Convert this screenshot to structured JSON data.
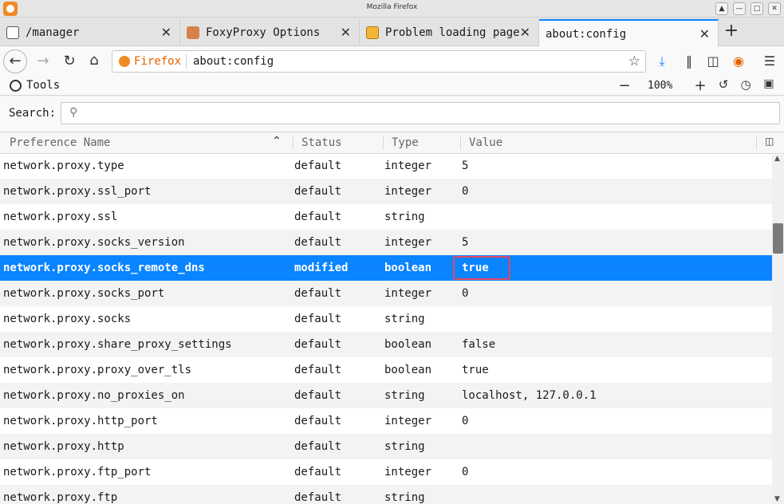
{
  "window": {
    "title": "Mozilla Firefox"
  },
  "tabs": [
    {
      "label": "/manager",
      "icon": "page-icon",
      "active": false
    },
    {
      "label": "FoxyProxy Options",
      "icon": "foxyproxy-icon",
      "active": false
    },
    {
      "label": "Problem loading page",
      "icon": "warning-icon",
      "active": false
    },
    {
      "label": "about:config",
      "icon": "none",
      "active": true
    }
  ],
  "navbar": {
    "identity_label": "Firefox",
    "url": "about:config"
  },
  "toolsbar": {
    "label": "Tools",
    "zoom": "100%"
  },
  "search": {
    "label": "Search:",
    "placeholder": "",
    "value": ""
  },
  "table": {
    "headers": {
      "name": "Preference Name",
      "status": "Status",
      "type": "Type",
      "value": "Value"
    },
    "sort": {
      "column": "name",
      "direction": "ascending"
    },
    "rows": [
      {
        "name": "network.proxy.type",
        "status": "default",
        "type": "integer",
        "value": "5"
      },
      {
        "name": "network.proxy.ssl_port",
        "status": "default",
        "type": "integer",
        "value": "0"
      },
      {
        "name": "network.proxy.ssl",
        "status": "default",
        "type": "string",
        "value": ""
      },
      {
        "name": "network.proxy.socks_version",
        "status": "default",
        "type": "integer",
        "value": "5"
      },
      {
        "name": "network.proxy.socks_remote_dns",
        "status": "modified",
        "type": "boolean",
        "value": "true",
        "selected": true
      },
      {
        "name": "network.proxy.socks_port",
        "status": "default",
        "type": "integer",
        "value": "0"
      },
      {
        "name": "network.proxy.socks",
        "status": "default",
        "type": "string",
        "value": ""
      },
      {
        "name": "network.proxy.share_proxy_settings",
        "status": "default",
        "type": "boolean",
        "value": "false"
      },
      {
        "name": "network.proxy.proxy_over_tls",
        "status": "default",
        "type": "boolean",
        "value": "true"
      },
      {
        "name": "network.proxy.no_proxies_on",
        "status": "default",
        "type": "string",
        "value": "localhost, 127.0.0.1"
      },
      {
        "name": "network.proxy.http_port",
        "status": "default",
        "type": "integer",
        "value": "0"
      },
      {
        "name": "network.proxy.http",
        "status": "default",
        "type": "string",
        "value": ""
      },
      {
        "name": "network.proxy.ftp_port",
        "status": "default",
        "type": "integer",
        "value": "0"
      },
      {
        "name": "network.proxy.ftp",
        "status": "default",
        "type": "string",
        "value": ""
      }
    ]
  },
  "colors": {
    "selection": "#0a84ff",
    "highlight_border": "#e8475f",
    "firefox_orange": "#e66000"
  }
}
